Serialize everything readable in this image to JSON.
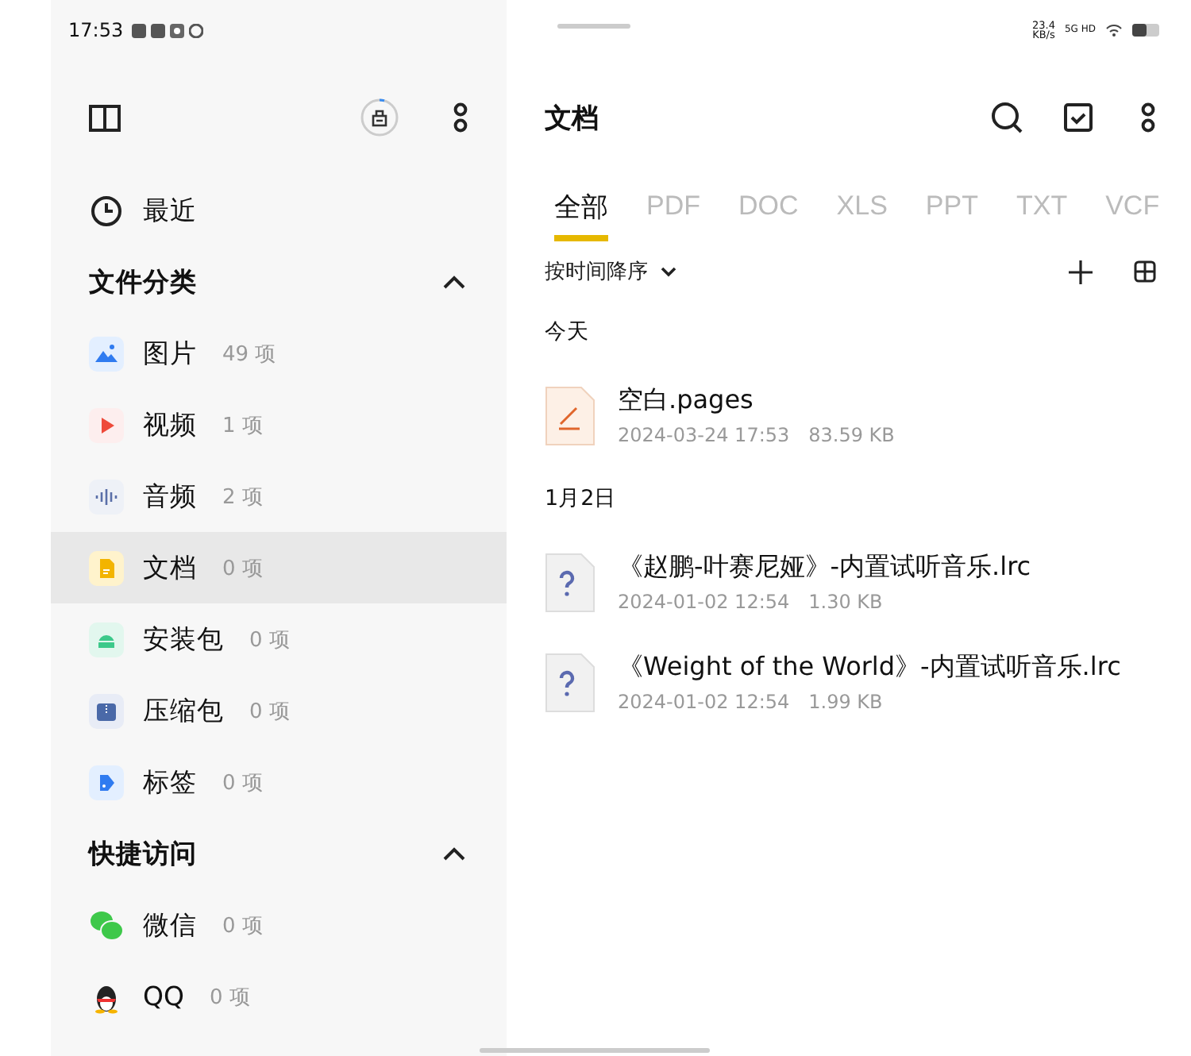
{
  "status_bar": {
    "time": "17:53",
    "speed_value": "23.4",
    "speed_unit": "KB/s",
    "network": "5G HD"
  },
  "sidebar": {
    "recent": "最近",
    "sections": [
      {
        "title": "文件分类",
        "expanded": true,
        "items": [
          {
            "label": "图片",
            "count": "49 项",
            "kind": "image",
            "selected": false
          },
          {
            "label": "视频",
            "count": "1 项",
            "kind": "video",
            "selected": false
          },
          {
            "label": "音频",
            "count": "2 项",
            "kind": "audio",
            "selected": false
          },
          {
            "label": "文档",
            "count": "0 项",
            "kind": "document",
            "selected": true
          },
          {
            "label": "安装包",
            "count": "0 项",
            "kind": "apk",
            "selected": false
          },
          {
            "label": "压缩包",
            "count": "0 项",
            "kind": "archive",
            "selected": false
          },
          {
            "label": "标签",
            "count": "0 项",
            "kind": "tag",
            "selected": false
          }
        ]
      },
      {
        "title": "快捷访问",
        "expanded": true,
        "items": [
          {
            "label": "微信",
            "count": "0 项",
            "kind": "wechat",
            "selected": false
          },
          {
            "label": "QQ",
            "count": "0 项",
            "kind": "qq",
            "selected": false
          }
        ]
      }
    ]
  },
  "main": {
    "title": "文档",
    "tabs": [
      {
        "label": "全部",
        "selected": true
      },
      {
        "label": "PDF",
        "selected": false
      },
      {
        "label": "DOC",
        "selected": false
      },
      {
        "label": "XLS",
        "selected": false
      },
      {
        "label": "PPT",
        "selected": false
      },
      {
        "label": "TXT",
        "selected": false
      },
      {
        "label": "VCF",
        "selected": false
      }
    ],
    "sort": "按时间降序",
    "groups": [
      {
        "date": "今天",
        "files": [
          {
            "name": "空白.pages",
            "time": "2024-03-24 17:53",
            "size": "83.59 KB",
            "kind": "pages"
          }
        ]
      },
      {
        "date": "1月2日",
        "files": [
          {
            "name": "《赵鹏-叶赛尼娅》-内置试听音乐.lrc",
            "time": "2024-01-02 12:54",
            "size": "1.30 KB",
            "kind": "unknown"
          },
          {
            "name": "《Weight of the World》-内置试听音乐.lrc",
            "time": "2024-01-02 12:54",
            "size": "1.99 KB",
            "kind": "unknown"
          }
        ]
      }
    ]
  }
}
